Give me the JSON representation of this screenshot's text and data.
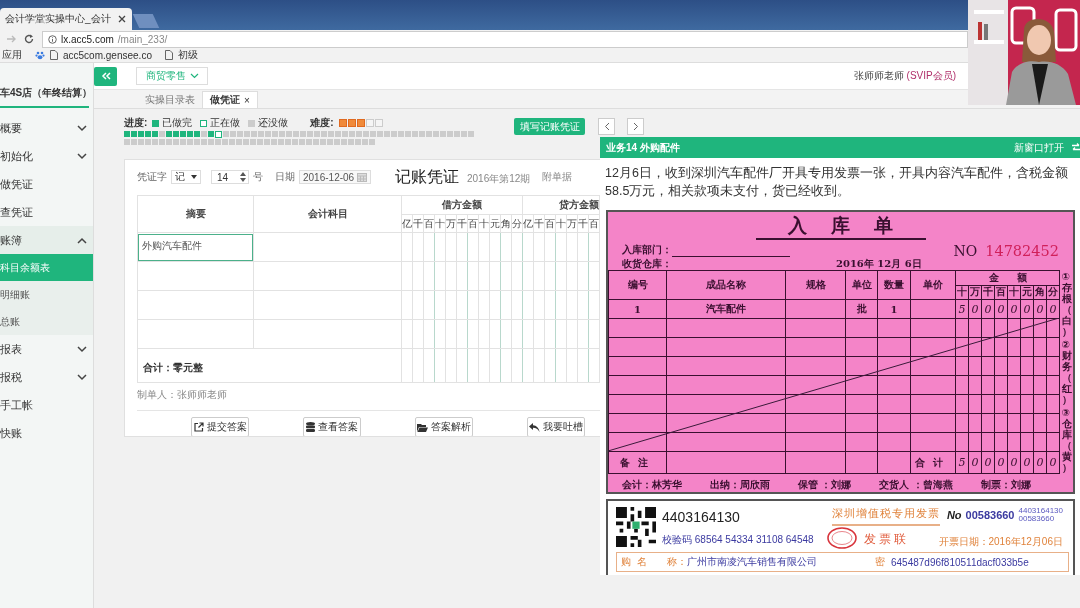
{
  "browser": {
    "tab_title": "会计学堂实操中心_会计",
    "url_host": "lx.acc5.com",
    "url_path": "/main_233/",
    "bookmarks": [
      "应用",
      "acc5com.gensee.co",
      "初级"
    ]
  },
  "sidebar": {
    "company": "车4S店（年终结算）",
    "items": [
      {
        "label": "概要",
        "kind": "group",
        "expanded": false,
        "selected": false
      },
      {
        "label": "初始化",
        "kind": "group",
        "expanded": false,
        "selected": false
      },
      {
        "label": "做凭证",
        "kind": "link",
        "selected": false
      },
      {
        "label": "查凭证",
        "kind": "link",
        "selected": false
      },
      {
        "label": "账簿",
        "kind": "group",
        "expanded": true,
        "selected": false,
        "children": [
          {
            "label": "科目余额表",
            "selected": true
          },
          {
            "label": "明细账",
            "selected": false
          },
          {
            "label": "总账",
            "selected": false
          }
        ]
      },
      {
        "label": "报表",
        "kind": "group",
        "expanded": false,
        "selected": false
      },
      {
        "label": "报税",
        "kind": "group",
        "expanded": false,
        "selected": false
      },
      {
        "label": "手工帐",
        "kind": "link",
        "selected": false
      },
      {
        "label": "快账",
        "kind": "link",
        "selected": false
      }
    ]
  },
  "topbar": {
    "industry": "商贸零售",
    "user": "张师师老师",
    "membership": "(SVIP会员)"
  },
  "tabs": [
    {
      "label": "实操目录表",
      "selected": false
    },
    {
      "label": "做凭证",
      "selected": true,
      "close": "×"
    }
  ],
  "progress": {
    "label": "进度:",
    "legend": [
      {
        "label": "已做完",
        "kind": "done"
      },
      {
        "label": "正在做",
        "kind": "current"
      },
      {
        "label": "还没做",
        "kind": "todo"
      }
    ],
    "difficulty_label": "难度:",
    "stars": 3,
    "cells": [
      {
        "kind": "done"
      },
      {
        "kind": "done"
      },
      {
        "kind": "done"
      },
      {
        "kind": "done"
      },
      {
        "kind": "done"
      },
      {
        "kind": "todo"
      },
      {
        "kind": "done"
      },
      {
        "kind": "done"
      },
      {
        "kind": "done"
      },
      {
        "kind": "done"
      },
      {
        "kind": "done"
      },
      {
        "kind": "todo"
      },
      {
        "kind": "done"
      },
      {
        "kind": "current"
      },
      {
        "kind": "todo"
      },
      {
        "kind": "todo"
      },
      {
        "kind": "todo"
      },
      {
        "kind": "todo"
      },
      {
        "kind": "todo"
      },
      {
        "kind": "todo"
      },
      {
        "kind": "todo"
      },
      {
        "kind": "todo"
      },
      {
        "kind": "todo"
      },
      {
        "kind": "todo"
      },
      {
        "kind": "todo"
      },
      {
        "kind": "todo"
      },
      {
        "kind": "todo"
      },
      {
        "kind": "todo"
      },
      {
        "kind": "todo"
      },
      {
        "kind": "todo"
      },
      {
        "kind": "todo"
      },
      {
        "kind": "todo"
      },
      {
        "kind": "todo"
      },
      {
        "kind": "todo"
      },
      {
        "kind": "todo"
      },
      {
        "kind": "todo"
      },
      {
        "kind": "todo"
      },
      {
        "kind": "todo"
      },
      {
        "kind": "todo"
      },
      {
        "kind": "todo"
      },
      {
        "kind": "todo"
      },
      {
        "kind": "todo"
      },
      {
        "kind": "todo"
      },
      {
        "kind": "todo"
      },
      {
        "kind": "todo"
      },
      {
        "kind": "todo"
      },
      {
        "kind": "todo"
      },
      {
        "kind": "todo"
      },
      {
        "kind": "todo"
      },
      {
        "kind": "todo"
      },
      {
        "kind": "todo"
      },
      {
        "kind": "todo"
      },
      {
        "kind": "todo"
      },
      {
        "kind": "todo"
      },
      {
        "kind": "todo"
      },
      {
        "kind": "todo"
      },
      {
        "kind": "todo"
      },
      {
        "kind": "todo"
      },
      {
        "kind": "todo"
      },
      {
        "kind": "todo"
      },
      {
        "kind": "todo"
      },
      {
        "kind": "todo"
      },
      {
        "kind": "todo"
      },
      {
        "kind": "todo"
      },
      {
        "kind": "todo"
      },
      {
        "kind": "todo"
      },
      {
        "kind": "todo"
      },
      {
        "kind": "todo"
      },
      {
        "kind": "todo"
      },
      {
        "kind": "todo"
      },
      {
        "kind": "todo"
      },
      {
        "kind": "todo"
      },
      {
        "kind": "todo"
      },
      {
        "kind": "todo"
      },
      {
        "kind": "todo"
      },
      {
        "kind": "todo"
      },
      {
        "kind": "todo"
      },
      {
        "kind": "todo"
      },
      {
        "kind": "todo"
      },
      {
        "kind": "todo"
      },
      {
        "kind": "todo"
      },
      {
        "kind": "todo"
      },
      {
        "kind": "todo"
      },
      {
        "kind": "todo"
      },
      {
        "kind": "todo"
      },
      {
        "kind": "todo"
      }
    ]
  },
  "fill_button": "填写记账凭证",
  "voucher": {
    "word_label": "凭证字",
    "word": "记",
    "number": "14",
    "number_suffix": "号",
    "date_label": "日期",
    "date": "2016-12-06",
    "title": "记账凭证",
    "period": "2016年第12期",
    "attachments_label": "附单据",
    "summary_header": "摘要",
    "account_header": "会计科目",
    "debit_header": "借方金额",
    "credit_header": "贷方金额",
    "debit_digits": [
      "亿",
      "千",
      "百",
      "十",
      "万",
      "千",
      "百",
      "十",
      "元",
      "角",
      "分"
    ],
    "credit_digits": [
      "亿",
      "千",
      "百",
      "十",
      "万",
      "千",
      "百"
    ],
    "rows": [
      {
        "summary": "外购汽车配件",
        "focused": true
      },
      {
        "focused": false
      },
      {
        "focused": false
      },
      {
        "focused": false
      }
    ],
    "total": "合计：零元整",
    "maker": "制单人：张师师老师",
    "buttons": [
      {
        "label": "提交答案",
        "kind": "submit"
      },
      {
        "label": "查看答案",
        "kind": "answer"
      },
      {
        "label": "答案解析",
        "kind": "analysis"
      },
      {
        "label": "我要吐槽",
        "kind": "feedback"
      }
    ]
  },
  "task": {
    "title": "业务14 外购配件",
    "open_new": "新窗口打开",
    "description": "12月6日，收到深圳汽车配件厂开具专用发票一张，开具内容汽车配件，含税金额58.5万元，相关款项未支付，货已经收到。",
    "receipt": {
      "title": "入库单",
      "dept_label": "入库部门：",
      "warehouse_label": "收货仓库：",
      "date": "2016年 12月 6日",
      "no_label": "NO",
      "no": "14782452",
      "columns": [
        "编号",
        "成品名称",
        "规格",
        "单位",
        "数量",
        "单价"
      ],
      "amount_label": "金额",
      "amount_digits": [
        "十",
        "万",
        "千",
        "百",
        "十",
        "元",
        "角",
        "分"
      ],
      "rows": [
        {
          "kind": "item",
          "no": "1",
          "name": "汽车配件",
          "unit": "批",
          "qty": "1",
          "amount": [
            "5",
            "0",
            "0",
            "0",
            "0",
            "0",
            "0",
            "0"
          ]
        },
        {
          "kind": "blank"
        },
        {
          "kind": "blank"
        },
        {
          "kind": "blank"
        },
        {
          "kind": "blank"
        },
        {
          "kind": "blank"
        },
        {
          "kind": "blank"
        },
        {
          "kind": "blank"
        }
      ],
      "remark_label": "备注",
      "total_label": "合计",
      "total": [
        "5",
        "0",
        "0",
        "0",
        "0",
        "0",
        "0",
        "0"
      ],
      "copies": [
        "①存根（白）",
        "②财务（红）",
        "③仓库（黄）"
      ],
      "signatures": [
        "会计：林芳华",
        "出纳：周欣雨",
        "保管 ：刘娜",
        "交货人 ：曾海燕",
        "制票：刘娜"
      ]
    },
    "invoice": {
      "code": "4403164130",
      "title": "深圳增值税专用发票",
      "subtitle": "发票联",
      "no_label": "No",
      "no": "00583660",
      "code_small": "4403164130",
      "no_small": "00583660",
      "check_code": "校验码 68564 54334 31108 64548",
      "date": "开票日期：2016年12月06日",
      "buyer_label": "购",
      "name_label": "名　　称：",
      "buyer_name": "广州市南凌汽车销售有限公司",
      "cipher_label": "密",
      "cipher": "645487d96f810511dacf033b5e"
    }
  }
}
